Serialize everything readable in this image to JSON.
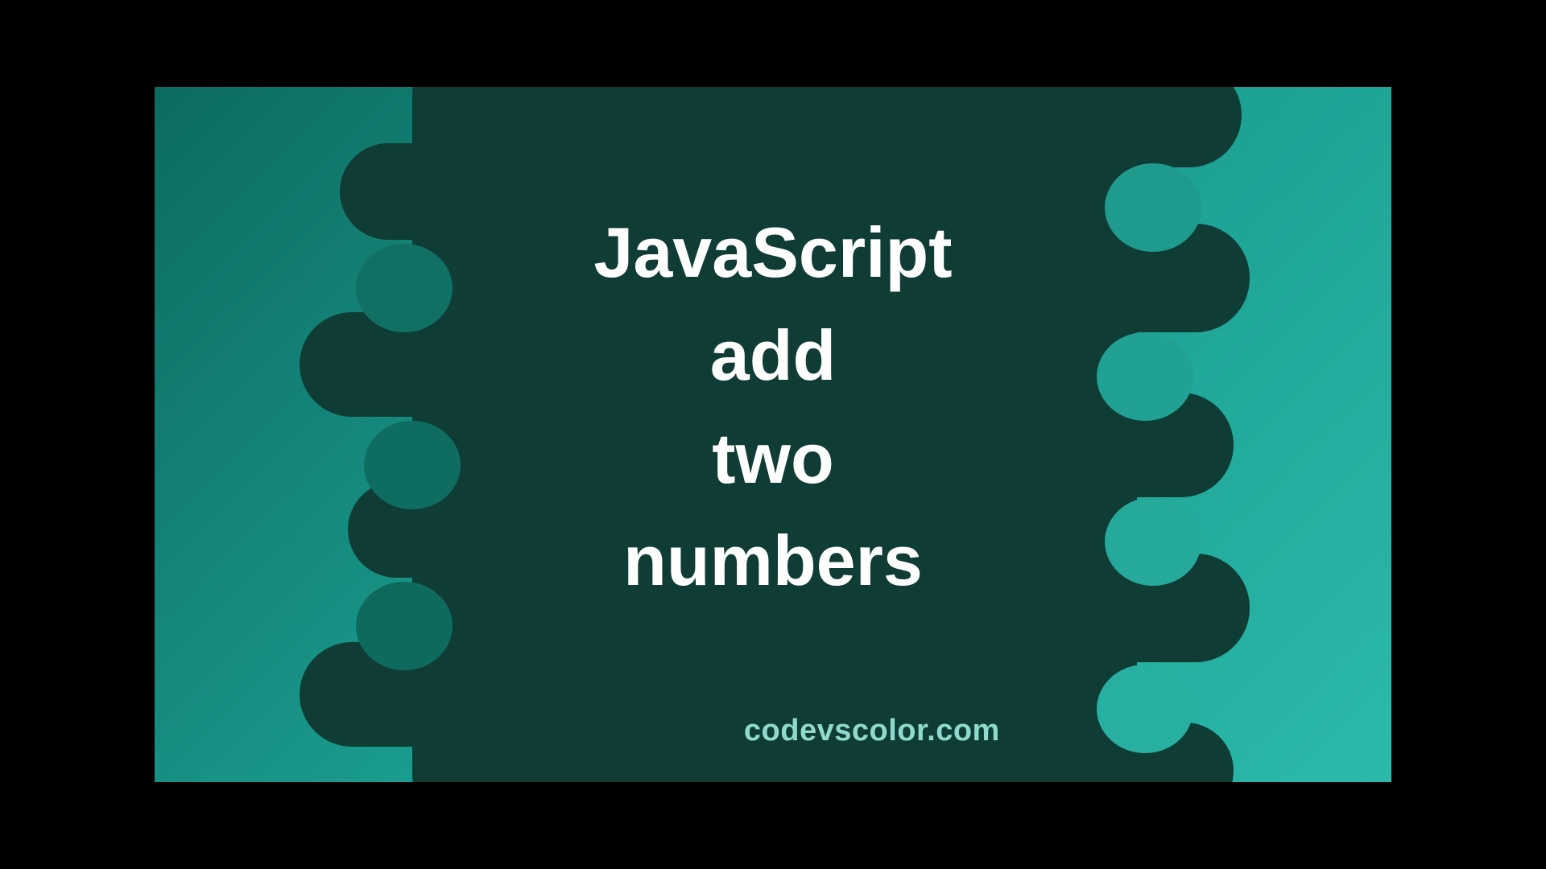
{
  "title_lines": "JavaScript\nadd\ntwo\nnumbers",
  "credit": "codevscolor.com",
  "colors": {
    "blob": "#0f3d35",
    "bg_gradient_start": "#0d6b5f",
    "bg_gradient_end": "#2bbaaa",
    "text": "#ffffff",
    "credit": "#8fd9cd"
  }
}
